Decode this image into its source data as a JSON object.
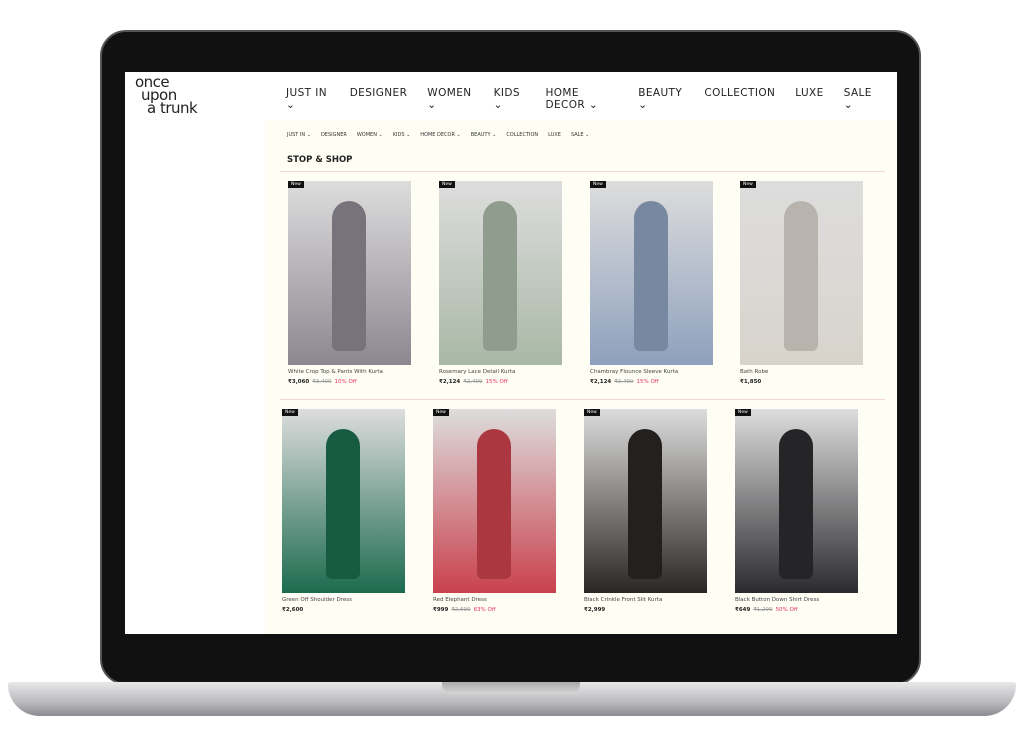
{
  "logo": {
    "line1": "once",
    "line2": "upon",
    "line3": "a trunk"
  },
  "nav": [
    "JUST IN ⌄",
    "DESIGNER",
    "WOMEN ⌄",
    "KIDS ⌄",
    "HOME DECOR ⌄",
    "BEAUTY ⌄",
    "COLLECTION",
    "LUXE",
    "SALE ⌄"
  ],
  "subnav": [
    "JUST IN ⌄",
    "DESIGNER",
    "WOMEN ⌄",
    "KIDS ⌄",
    "HOME DECOR ⌄",
    "BEAUTY ⌄",
    "COLLECTION",
    "LUXE",
    "SALE ⌄"
  ],
  "section_title": "STOP & SHOP",
  "badge": "New",
  "products": [
    {
      "name": "White Crop Top & Pants With Kurta",
      "price": "₹3,060",
      "mrp": "₹3,400",
      "discount": "10% Off",
      "color": "#8d8790"
    },
    {
      "name": "Rosemary Lace Detail Kurta",
      "price": "₹2,124",
      "mrp": "₹2,499",
      "discount": "15% Off",
      "color": "#a9b8a6"
    },
    {
      "name": "Chambray Flounce Sleeve Kurta",
      "price": "₹2,124",
      "mrp": "₹2,499",
      "discount": "15% Off",
      "color": "#8ea0bd"
    },
    {
      "name": "Bath Robe",
      "price": "₹1,850",
      "mrp": "",
      "discount": "",
      "color": "#d8d4cc"
    },
    {
      "name": "Green Off Shoulder Dress",
      "price": "₹2,600",
      "mrp": "",
      "discount": "",
      "color": "#1c6b4f"
    },
    {
      "name": "Red Elephant Dress",
      "price": "₹999",
      "mrp": "₹2,699",
      "discount": "63% Off",
      "color": "#c9414d"
    },
    {
      "name": "Black Crinkle Front Slit Kurta",
      "price": "₹2,999",
      "mrp": "",
      "discount": "",
      "color": "#2a2624"
    },
    {
      "name": "Black Button Down Shirt Dress",
      "price": "₹649",
      "mrp": "₹1,299",
      "discount": "50% Off",
      "color": "#2b2b2e"
    }
  ]
}
